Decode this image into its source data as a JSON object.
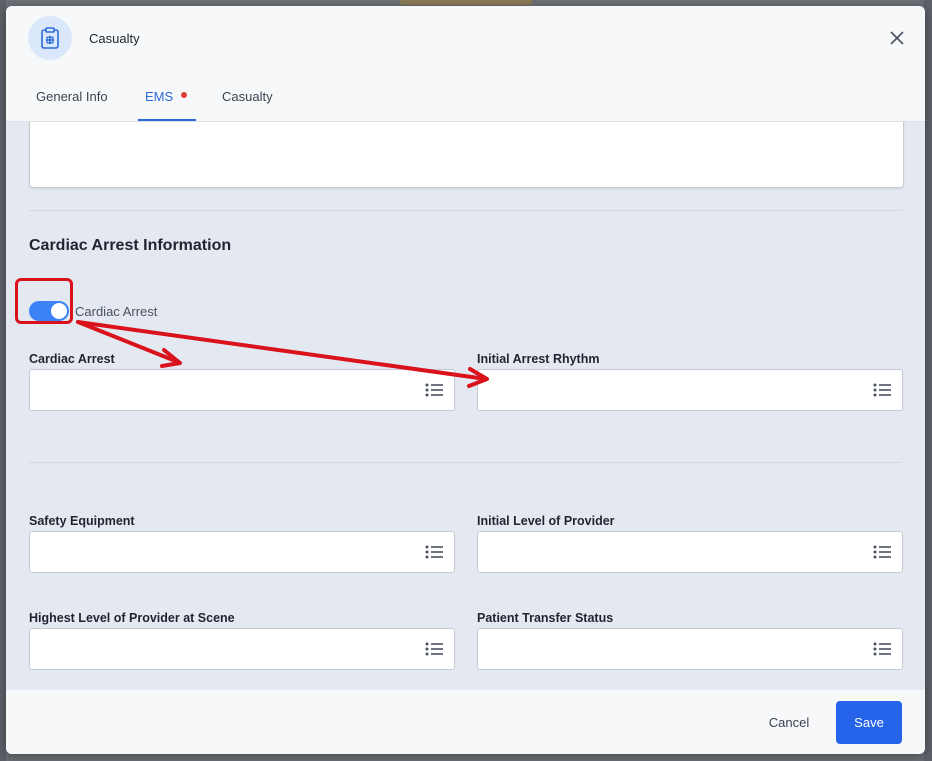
{
  "header": {
    "title": "Casualty",
    "icon": "clipboard-medical-icon",
    "close_icon": "close-icon"
  },
  "tabs": [
    {
      "label": "General Info",
      "active": false,
      "has_indicator": false
    },
    {
      "label": "EMS",
      "active": true,
      "has_indicator": true
    },
    {
      "label": "Casualty",
      "active": false,
      "has_indicator": false
    }
  ],
  "section": {
    "title": "Cardiac Arrest Information"
  },
  "toggle": {
    "label": "Cardiac Arrest",
    "checked": true
  },
  "fields": [
    {
      "label": "Cardiac Arrest",
      "value": ""
    },
    {
      "label": "Initial Arrest Rhythm",
      "value": ""
    },
    {
      "label": "Safety Equipment",
      "value": ""
    },
    {
      "label": "Initial Level of Provider",
      "value": ""
    },
    {
      "label": "Highest Level of Provider at Scene",
      "value": ""
    },
    {
      "label": "Patient Transfer Status",
      "value": ""
    }
  ],
  "footer": {
    "cancel_label": "Cancel",
    "save_label": "Save"
  },
  "colors": {
    "accent": "#2563eb",
    "tab_active": "#2c6bd8",
    "indicator": "#e03b3b",
    "annotation": "#d9121b"
  }
}
